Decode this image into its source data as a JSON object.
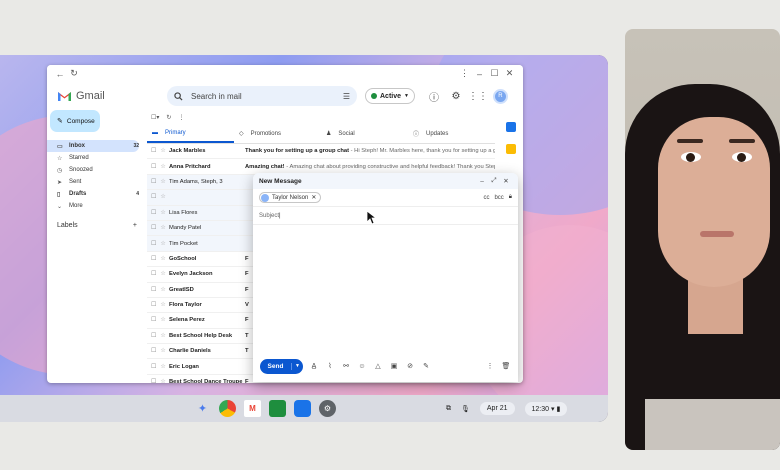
{
  "browser": {
    "window_controls": [
      "⋮",
      "–",
      "☐",
      "✕"
    ]
  },
  "gmail": {
    "logo_text": "Gmail",
    "search_placeholder": "Search in mail",
    "status": "Active",
    "avatar_initial": "R"
  },
  "sidebar": {
    "compose_label": "Compose",
    "items": [
      {
        "label": "Inbox",
        "count": "32",
        "icon": "inbox-icon"
      },
      {
        "label": "Starred",
        "count": "",
        "icon": "star-icon"
      },
      {
        "label": "Snoozed",
        "count": "",
        "icon": "clock-icon"
      },
      {
        "label": "Sent",
        "count": "",
        "icon": "send-icon"
      },
      {
        "label": "Drafts",
        "count": "4",
        "icon": "draft-icon"
      },
      {
        "label": "More",
        "count": "",
        "icon": "chevron-down-icon"
      }
    ],
    "labels_title": "Labels",
    "labels_add": "+"
  },
  "tabs": [
    "Primary",
    "Promotions",
    "Social",
    "Updates"
  ],
  "emails": [
    {
      "sender": "Jack Marbles",
      "subject": "Thank you for setting up a group chat",
      "snippet": " - Hi Steph! Mr. Marbles here, thank you for setting up a gro",
      "unread": true
    },
    {
      "sender": "Anna Pritchard",
      "subject": "Amazing chat!",
      "snippet": " - Amazing chat about providing constructive and helpful feedback! Thank you Steph",
      "unread": true
    },
    {
      "sender": "Tim Adams, Steph, 3",
      "subject": "",
      "snippet": "",
      "unread": false
    },
    {
      "sender": "",
      "subject": "",
      "snippet": "",
      "unread": false
    },
    {
      "sender": "Lisa Flores",
      "subject": "",
      "snippet": "",
      "unread": false
    },
    {
      "sender": "Mandy Patel",
      "subject": "",
      "snippet": "",
      "unread": false
    },
    {
      "sender": "Tim Pocket",
      "subject": "",
      "snippet": "",
      "unread": false
    },
    {
      "sender": "GoSchool",
      "subject": "F",
      "snippet": "",
      "unread": true
    },
    {
      "sender": "Evelyn Jackson",
      "subject": "F",
      "snippet": "",
      "unread": true
    },
    {
      "sender": "GreatISD",
      "subject": "F",
      "snippet": "",
      "unread": true
    },
    {
      "sender": "Flora Taylor",
      "subject": "V",
      "snippet": "",
      "unread": true
    },
    {
      "sender": "Selena Perez",
      "subject": "F",
      "snippet": "",
      "unread": true
    },
    {
      "sender": "Best School Help Desk",
      "subject": "T",
      "snippet": "",
      "unread": true
    },
    {
      "sender": "Charlie Daniels",
      "subject": "T",
      "snippet": "",
      "unread": true
    },
    {
      "sender": "Eric Logan",
      "subject": "",
      "snippet": "",
      "unread": true
    },
    {
      "sender": "Best School Dance Troupe",
      "subject": "F",
      "snippet": "",
      "unread": true
    }
  ],
  "compose_window": {
    "title": "New Message",
    "recipient": "Taylor Nelson",
    "cc": "cc",
    "bcc": "bcc",
    "subject_placeholder": "Subject",
    "send_label": "Send"
  },
  "shelf": {
    "date": "Apr 21",
    "time": "12:30"
  }
}
